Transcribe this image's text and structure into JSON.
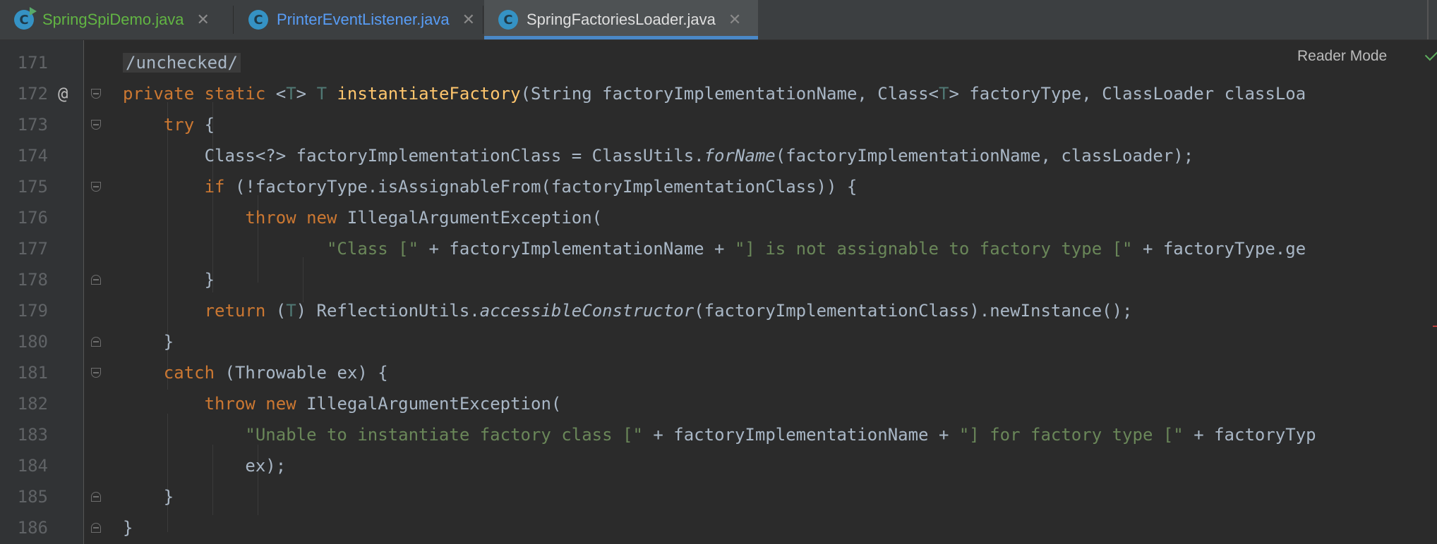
{
  "tabs": [
    {
      "label": "SpringSpiDemo.java",
      "icon": "java-class-run-icon",
      "color": "#62b543",
      "active": false
    },
    {
      "label": "PrinterEventListener.java",
      "icon": "java-class-icon",
      "color": "#589df6",
      "active": false
    },
    {
      "label": "SpringFactoriesLoader.java",
      "icon": "java-class-icon",
      "color": "#dfdfdf",
      "active": true
    }
  ],
  "reader_mode": "Reader Mode",
  "line_numbers": [
    "171",
    "172",
    "173",
    "174",
    "175",
    "176",
    "177",
    "178",
    "179",
    "180",
    "181",
    "182",
    "183",
    "184",
    "185",
    "186"
  ],
  "gutter_marker": "@",
  "code": {
    "l171": "/unchecked/",
    "l172": {
      "kw1": "private",
      "kw2": "static",
      "lt": "<",
      "t1": "T",
      "gt": ">",
      "t2": "T",
      "name": "instantiateFactory",
      "rest": "(String factoryImplementationName, Class<",
      "t3": "T",
      "rest2": "> factoryType, ClassLoader classLoa"
    },
    "l173": {
      "kw": "try",
      "rest": " {"
    },
    "l174": {
      "pre": "Class<?> factoryImplementationClass = ClassUtils.",
      "it": "forName",
      "post": "(factoryImplementationName, classLoader);"
    },
    "l175": {
      "kw": "if",
      "rest": " (!factoryType.isAssignableFrom(factoryImplementationClass)) {"
    },
    "l176": {
      "kw1": "throw",
      "kw2": "new",
      "rest": " IllegalArgumentException("
    },
    "l177": {
      "s1": "\"Class [\"",
      "m1": " + factoryImplementationName + ",
      "s2": "\"] is not assignable to factory type [\"",
      "m2": " + factoryType.ge"
    },
    "l178": "}",
    "l179": {
      "kw": "return",
      "p1": " (",
      "t": "T",
      "p2": ") ReflectionUtils.",
      "it": "accessibleConstructor",
      "post": "(factoryImplementationClass).newInstance();"
    },
    "l180": "}",
    "l181": {
      "kw": "catch",
      "rest": " (Throwable ex) {"
    },
    "l182": {
      "kw1": "throw",
      "kw2": "new",
      "rest": " IllegalArgumentException("
    },
    "l183": {
      "s1": "\"Unable to instantiate factory class [\"",
      "m1": " + factoryImplementationName + ",
      "s2": "\"] for factory type [\"",
      "m2": " + factoryTyp"
    },
    "l184": "ex);",
    "l185": "}",
    "l186": "}"
  }
}
